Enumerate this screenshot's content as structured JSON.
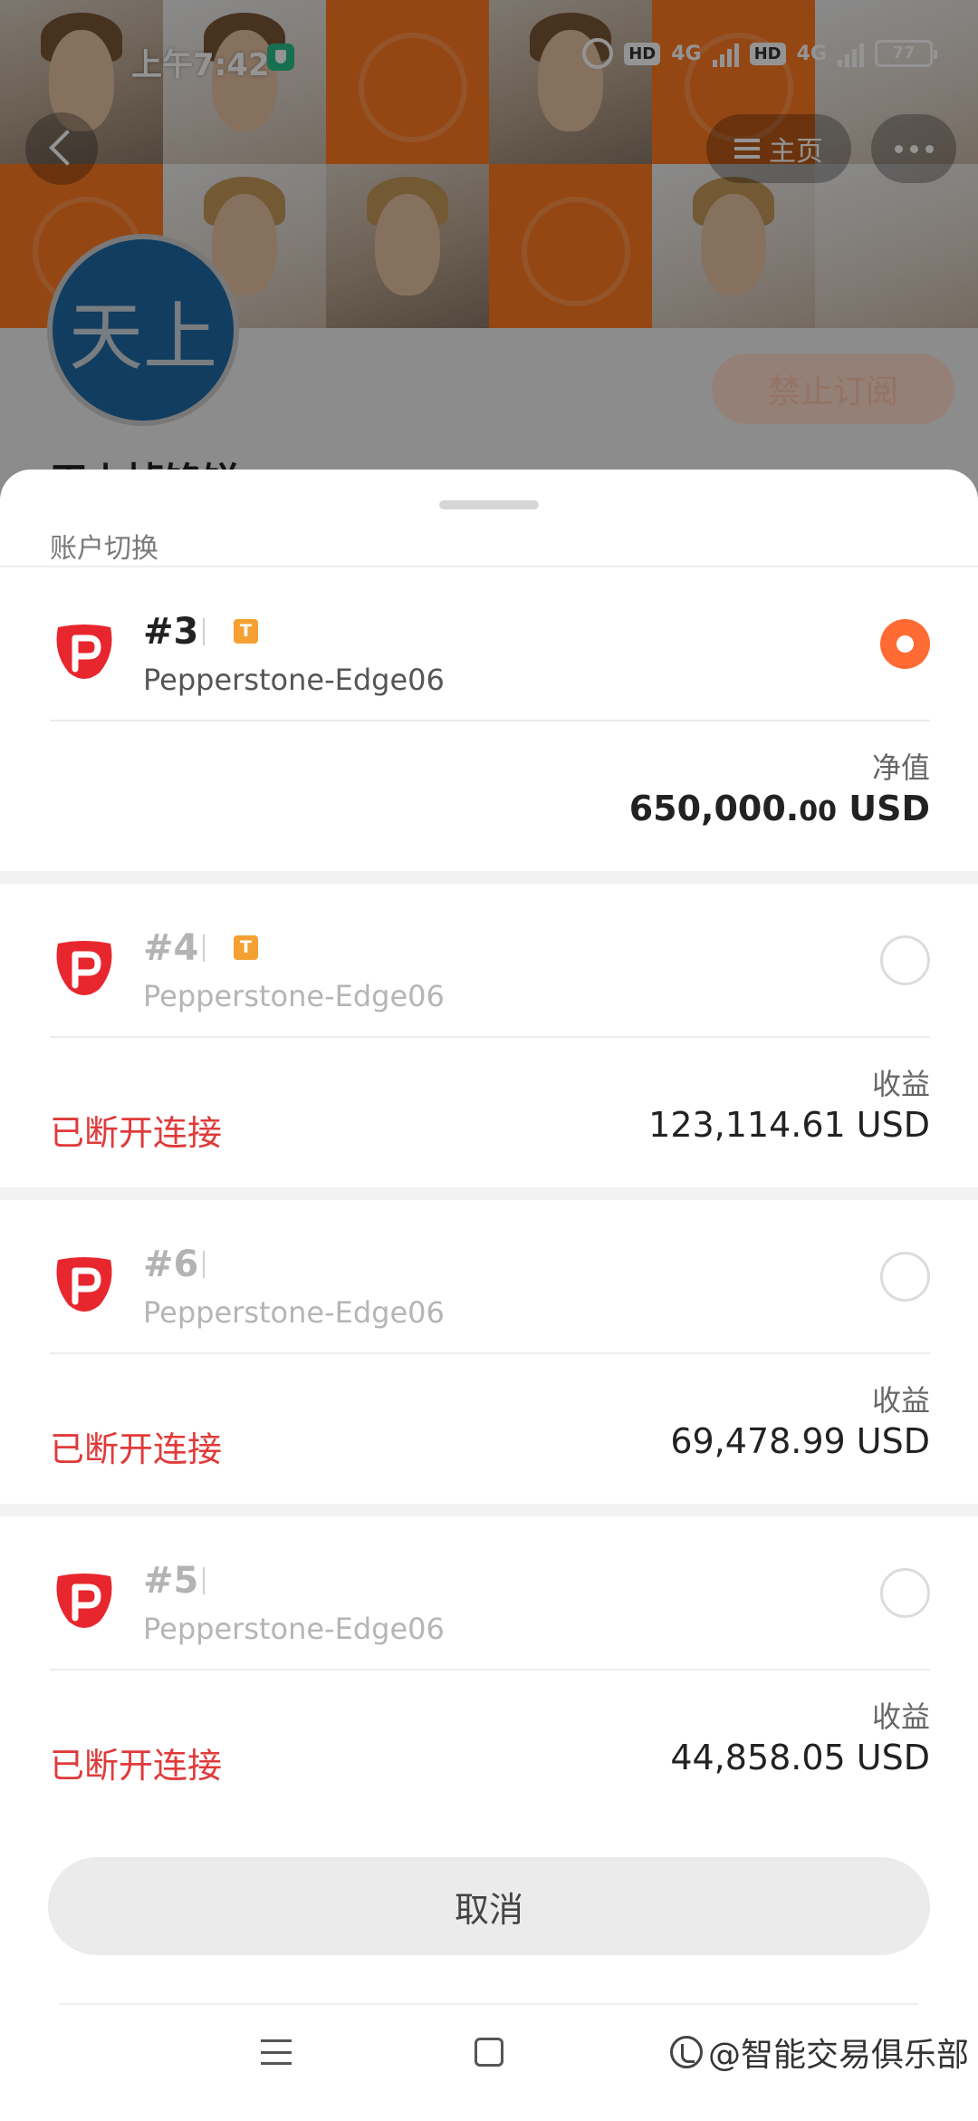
{
  "status_bar": {
    "time": "上午7:42",
    "network_1": "4G",
    "network_2": "4G",
    "hd": "HD",
    "battery": "77"
  },
  "profile": {
    "avatar_text": "天上",
    "name": "天上掉馅饼",
    "home_label": "主页",
    "block_label": "禁止订阅"
  },
  "sheet": {
    "title": "账户切换",
    "cancel_label": "取消",
    "accounts": [
      {
        "number": "#3",
        "badge": "T",
        "server": "Pepperstone-Edge06",
        "selected": true,
        "metric_label": "净值",
        "value_main": "650,000.",
        "value_cents": "00",
        "currency": "USD",
        "status": ""
      },
      {
        "number": "#4",
        "badge": "T",
        "server": "Pepperstone-Edge06",
        "selected": false,
        "metric_label": "收益",
        "value": "123,114.61 USD",
        "status": "已断开连接"
      },
      {
        "number": "#6",
        "badge": "",
        "server": "Pepperstone-Edge06",
        "selected": false,
        "metric_label": "收益",
        "value": "69,478.99 USD",
        "status": "已断开连接"
      },
      {
        "number": "#5",
        "badge": "",
        "server": "Pepperstone-Edge06",
        "selected": false,
        "metric_label": "收益",
        "value": "44,858.05 USD",
        "status": "已断开连接"
      }
    ]
  },
  "watermark": "智能交易俱乐部",
  "colors": {
    "accent": "#ff6b33",
    "disconnected": "#e03a3a",
    "badge": "#f5a032",
    "brand_logo": "#e8262e"
  }
}
